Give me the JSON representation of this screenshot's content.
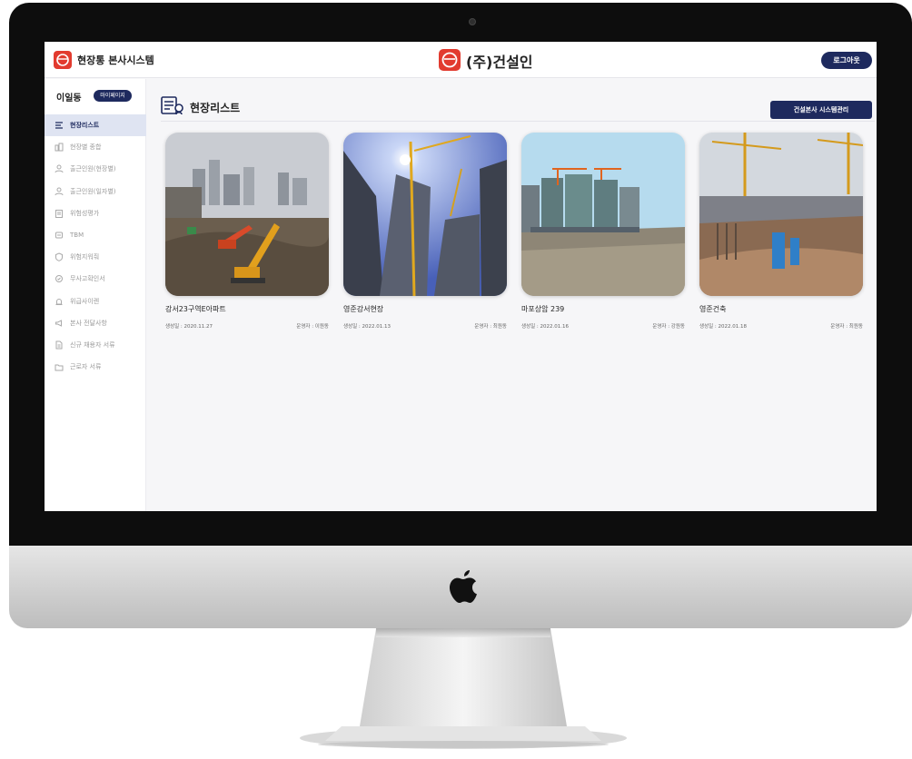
{
  "header": {
    "app_title": "현장통 본사시스템",
    "brand_name": "(주)건설인",
    "logout_label": "로그아웃",
    "brand_color": "#e23b2f",
    "accent_color": "#1e2a5e"
  },
  "sidebar": {
    "user_name": "이일동",
    "mypage_label": "마이페이지",
    "items": [
      {
        "label": "현장리스트",
        "icon": "list-icon"
      },
      {
        "label": "현장별 종합",
        "icon": "buildings-icon"
      },
      {
        "label": "출근인원(현장별)",
        "icon": "worker-icon"
      },
      {
        "label": "출근인원(일자별)",
        "icon": "worker-icon"
      },
      {
        "label": "위험성평가",
        "icon": "clipboard-icon"
      },
      {
        "label": "TBM",
        "icon": "meeting-icon"
      },
      {
        "label": "위험지워줘",
        "icon": "shield-icon"
      },
      {
        "label": "무사고확인서",
        "icon": "document-icon"
      },
      {
        "label": "위급사이렌",
        "icon": "siren-icon"
      },
      {
        "label": "본사 전달사항",
        "icon": "megaphone-icon"
      },
      {
        "label": "신규 채용자 서류",
        "icon": "file-icon"
      },
      {
        "label": "근로자 서류",
        "icon": "folder-icon"
      }
    ]
  },
  "main": {
    "page_title": "현장리스트",
    "admin_button": "건설본사 시스템관리",
    "sites": [
      {
        "name": "강서23구역E아파트",
        "date": "생성일 : 2020.11.27",
        "owner": "운영자 : 이원동"
      },
      {
        "name": "영준강서현장",
        "date": "생성일 : 2022.01.13",
        "owner": "운영자 : 최원동"
      },
      {
        "name": "마포상암 239",
        "date": "생성일 : 2022.01.16",
        "owner": "운영자 : 강원동"
      },
      {
        "name": "영준건축",
        "date": "생성일 : 2022.01.18",
        "owner": "운영자 : 최원동"
      }
    ]
  }
}
